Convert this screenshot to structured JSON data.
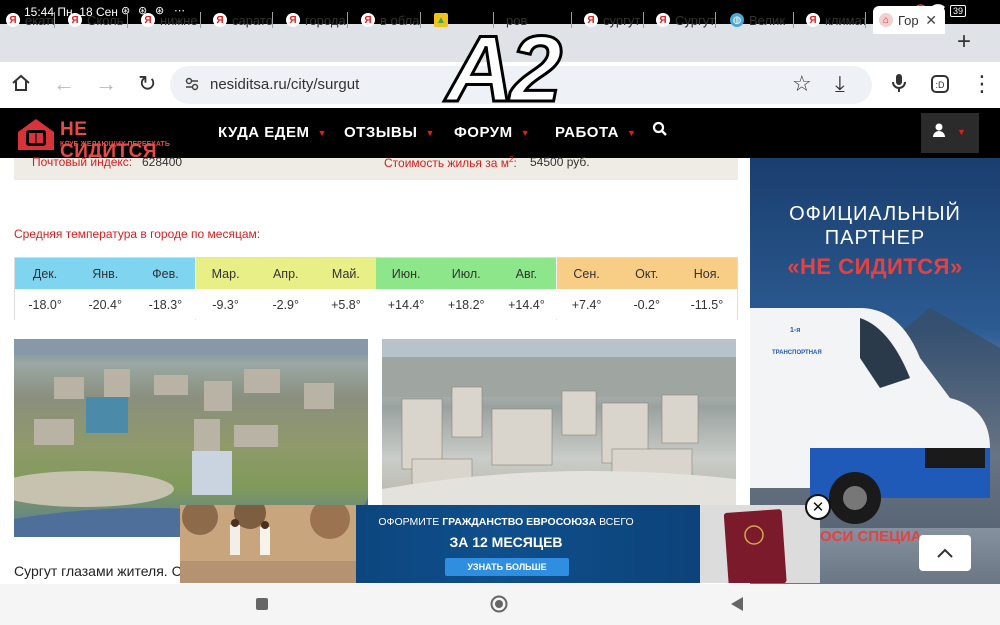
{
  "status_bar": {
    "time_date": "15:44 Пн, 18 Сен",
    "more": "⋯",
    "battery": "39"
  },
  "tabs": [
    {
      "label": "екатер",
      "favicon": "yandex"
    },
    {
      "label": "Сколь",
      "favicon": "yandex"
    },
    {
      "label": "нижне",
      "favicon": "yandex"
    },
    {
      "label": "сарато",
      "favicon": "yandex"
    },
    {
      "label": "города",
      "favicon": "yandex"
    },
    {
      "label": "в облас",
      "favicon": "yandex"
    },
    {
      "label": "",
      "favicon": "image"
    },
    {
      "label": "ров",
      "favicon": "none"
    },
    {
      "label": "сургут",
      "favicon": "yandex"
    },
    {
      "label": "Сургут",
      "favicon": "yandex"
    },
    {
      "label": "Велик",
      "favicon": "globe"
    },
    {
      "label": "климат",
      "favicon": "yandex"
    },
    {
      "label": "Гор",
      "favicon": "site",
      "active": true
    }
  ],
  "toolbar": {
    "url": "nesiditsa.ru/city/surgut"
  },
  "site_nav": {
    "logo_title": "НЕ СИДИТСЯ",
    "logo_subtitle": "КЛУБ ЖЕЛАЮЩИХ ПЕРЕЕХАТЬ",
    "items": [
      "КУДА ЕДЕМ",
      "ОТЗЫВЫ",
      "ФОРУМ",
      "РАБОТА"
    ]
  },
  "info": {
    "postal_label": "Почтовый индекс:",
    "postal_value": "628400",
    "housing_label": "Стоимость жилья за м",
    "housing_sup": "2",
    "housing_colon": ":",
    "housing_value": "54500 руб."
  },
  "temperature": {
    "label": "Средняя температура в городе по месяцам:",
    "months": [
      {
        "name": "Дек.",
        "value": "-18.0°",
        "color": "#7fd4ef"
      },
      {
        "name": "Янв.",
        "value": "-20.4°",
        "color": "#7fd4ef"
      },
      {
        "name": "Фев.",
        "value": "-18.3°",
        "color": "#7fd4ef"
      },
      {
        "name": "Мар.",
        "value": "-9.3°",
        "color": "#e7ef86"
      },
      {
        "name": "Апр.",
        "value": "-2.9°",
        "color": "#e7ef86"
      },
      {
        "name": "Май.",
        "value": "+5.8°",
        "color": "#e7ef86"
      },
      {
        "name": "Июн.",
        "value": "+14.4°",
        "color": "#8ee68a"
      },
      {
        "name": "Июл.",
        "value": "+18.2°",
        "color": "#8ee68a"
      },
      {
        "name": "Авг.",
        "value": "+14.4°",
        "color": "#8ee68a"
      },
      {
        "name": "Сен.",
        "value": "+7.4°",
        "color": "#f8cd86"
      },
      {
        "name": "Окт.",
        "value": "-0.2°",
        "color": "#f8cd86"
      },
      {
        "name": "Ноя.",
        "value": "-11.5°",
        "color": "#f8cd86"
      }
    ]
  },
  "caption": "Сургут глазами жителя. С",
  "side_ad": {
    "line1": "ОФИЦИАЛЬНЫЙ",
    "line2": "ПАРТНЕР",
    "line3": "«НЕ СИДИТСЯ»",
    "van_text1": "1-я",
    "van_text2": "ТРАНСПОРТНАЯ",
    "strip": "ОСИ СПЕЦИА"
  },
  "bottom_ad": {
    "line1_pre": "ОФОРМИТЕ ",
    "line1_bold": "ГРАЖДАНСТВО ЕВРОСОЮЗА",
    "line1_post": " ВСЕГО",
    "line2": "ЗА 12 МЕСЯЦЕВ",
    "button": "УЗНАТЬ БОЛЬШЕ"
  },
  "overlay_mark": "A2",
  "colors": {
    "brand_red": "#e31c1c",
    "nav_bg": "#000000"
  }
}
